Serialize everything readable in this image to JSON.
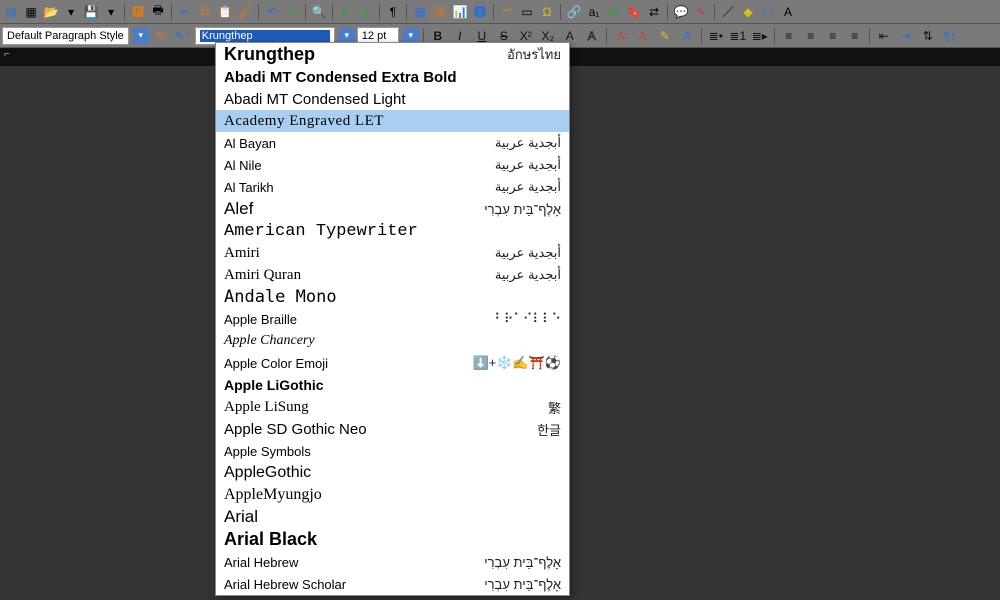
{
  "paragraph_style": {
    "value": "Default Paragraph Style"
  },
  "font_name": {
    "value": "Krungthep"
  },
  "font_size": {
    "value": "12 pt"
  },
  "toolbar2": {
    "bold": "B",
    "italic": "I",
    "underline": "U",
    "strike": "S",
    "super": "X²",
    "sub": "X₂",
    "shadow": "A",
    "outline": "A"
  },
  "fonts": [
    {
      "name": "Krungthep",
      "sample": "อักษรไทย",
      "style": "font-weight:bold;font-size:18px;"
    },
    {
      "name": "Abadi MT Condensed Extra Bold",
      "sample": "",
      "style": "font-weight:900;font-stretch:condensed;"
    },
    {
      "name": "Abadi MT Condensed Light",
      "sample": "",
      "style": "font-weight:300;font-stretch:condensed;"
    },
    {
      "name": "Academy Engraved LET",
      "sample": "",
      "style": "font-family:serif;letter-spacing:.5px;",
      "highlight": true
    },
    {
      "name": "Al Bayan",
      "sample": "أبجدية عربية",
      "style": "font-size:13px;"
    },
    {
      "name": "Al Nile",
      "sample": "أبجدية عربية",
      "style": "font-size:13px;"
    },
    {
      "name": "Al Tarikh",
      "sample": "أبجدية عربية",
      "style": "font-size:13px;"
    },
    {
      "name": "Alef",
      "sample": "אָלֶף־בֵּית עִבְרִי",
      "style": "font-size:17px;"
    },
    {
      "name": "American Typewriter",
      "sample": "",
      "style": "font-family:'Courier New',monospace;font-size:17px;"
    },
    {
      "name": "Amiri",
      "sample": "أبجدية عربية",
      "style": "font-family:serif;"
    },
    {
      "name": "Amiri Quran",
      "sample": "أبجدية عربية",
      "style": "font-family:serif;"
    },
    {
      "name": "Andale Mono",
      "sample": "",
      "style": "font-family:monospace;font-size:17px;"
    },
    {
      "name": "Apple Braille",
      "sample": "⠃⠗⠁⠊⠇⠇⠑",
      "style": "font-size:13px;"
    },
    {
      "name": "Apple Chancery",
      "sample": "",
      "style": "font-style:italic;font-family:cursive;font-size:14px;"
    },
    {
      "name": "Apple Color Emoji",
      "sample": "⬇️+❄️✍️⛩️⚽",
      "style": "font-size:13px;"
    },
    {
      "name": "Apple LiGothic",
      "sample": "",
      "style": "font-weight:bold;font-size:14px;"
    },
    {
      "name": "Apple LiSung",
      "sample": "繁",
      "style": "font-family:serif;"
    },
    {
      "name": "Apple SD Gothic Neo",
      "sample": "한글",
      "style": ""
    },
    {
      "name": "Apple Symbols",
      "sample": "",
      "style": "font-size:13px;"
    },
    {
      "name": "AppleGothic",
      "sample": "",
      "style": "font-size:16px;"
    },
    {
      "name": "AppleMyungjo",
      "sample": "",
      "style": "font-family:serif;font-size:16px;"
    },
    {
      "name": "Arial",
      "sample": "",
      "style": "font-size:17px;"
    },
    {
      "name": "Arial Black",
      "sample": "",
      "style": "font-weight:900;font-size:18px;"
    },
    {
      "name": "Arial Hebrew",
      "sample": "אָלֶף־בֵּית עִבְרִי",
      "style": "font-size:13px;"
    },
    {
      "name": "Arial Hebrew Scholar",
      "sample": "אָלֶף־בֵּית עִבְרִי",
      "style": "font-size:13px;"
    }
  ]
}
